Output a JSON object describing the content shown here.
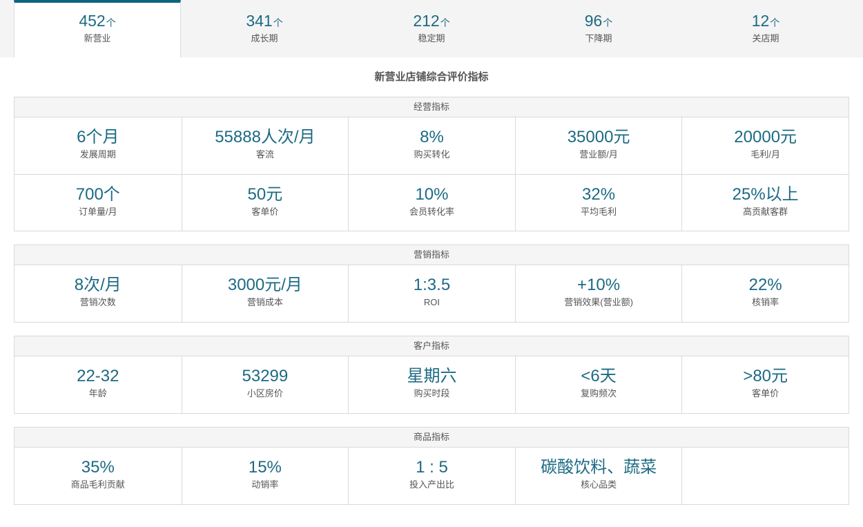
{
  "tabs": [
    {
      "value": "452",
      "unit": "个",
      "label": "新营业"
    },
    {
      "value": "341",
      "unit": "个",
      "label": "成长期"
    },
    {
      "value": "212",
      "unit": "个",
      "label": "稳定期"
    },
    {
      "value": "96",
      "unit": "个",
      "label": "下降期"
    },
    {
      "value": "12",
      "unit": "个",
      "label": "关店期"
    }
  ],
  "active_tab": "新营业",
  "accent_color": "#1c6a84",
  "page_title": "新营业店铺综合评价指标",
  "sections": {
    "operation": {
      "title": "经营指标",
      "cells": [
        {
          "value": "6个月",
          "label": "发展周期"
        },
        {
          "value": "55888人次/月",
          "label": "客流"
        },
        {
          "value": "8%",
          "label": "购买转化"
        },
        {
          "value": "35000元",
          "label": "营业额/月"
        },
        {
          "value": "20000元",
          "label": "毛利/月"
        },
        {
          "value": "700个",
          "label": "订单量/月"
        },
        {
          "value": "50元",
          "label": "客单价"
        },
        {
          "value": "10%",
          "label": "会员转化率"
        },
        {
          "value": "32%",
          "label": "平均毛利"
        },
        {
          "value": "25%以上",
          "label": "高贡献客群"
        }
      ]
    },
    "marketing": {
      "title": "营销指标",
      "cells": [
        {
          "value": "8次/月",
          "label": "营销次数"
        },
        {
          "value": "3000元/月",
          "label": "营销成本"
        },
        {
          "value": "1:3.5",
          "label": "ROI"
        },
        {
          "value": "+10%",
          "label": "营销效果(营业额)"
        },
        {
          "value": "22%",
          "label": "核销率"
        }
      ]
    },
    "customer": {
      "title": "客户指标",
      "cells": [
        {
          "value": "22-32",
          "label": "年龄"
        },
        {
          "value": "53299",
          "label": "小区房价"
        },
        {
          "value": "星期六",
          "label": "购买时段"
        },
        {
          "value": "<6天",
          "label": "复购频次"
        },
        {
          "value": ">80元",
          "label": "客单价"
        }
      ]
    },
    "product": {
      "title": "商品指标",
      "cells": [
        {
          "value": "35%",
          "label": "商品毛利贡献"
        },
        {
          "value": "15%",
          "label": "动销率"
        },
        {
          "value": "1 : 5",
          "label": "投入产出比"
        },
        {
          "value": "碳酸饮料、蔬菜",
          "label": "核心品类"
        }
      ]
    }
  }
}
